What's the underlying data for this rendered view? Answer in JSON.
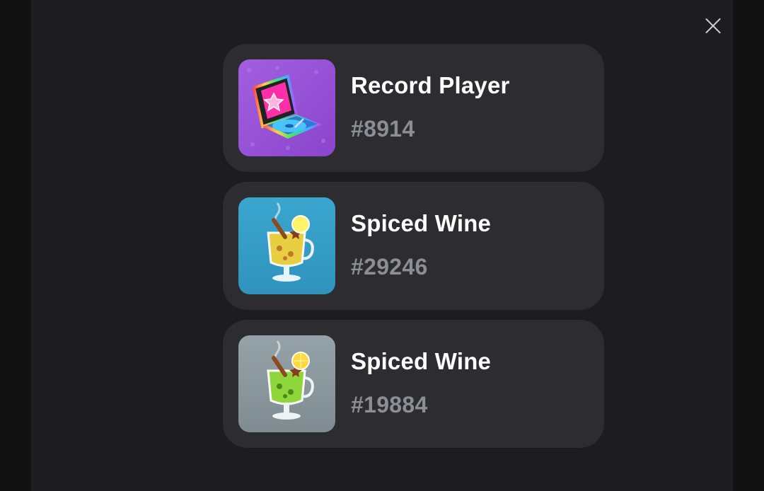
{
  "close_icon": "close-icon",
  "items": [
    {
      "title": "Record Player",
      "number": "#8914",
      "bg": "#9b59d6",
      "icon": "record-player-icon"
    },
    {
      "title": "Spiced Wine",
      "number": "#29246",
      "bg": "#3aa3c9",
      "icon": "spiced-wine-icon"
    },
    {
      "title": "Spiced Wine",
      "number": "#19884",
      "bg": "#8c9aa0",
      "icon": "spiced-wine-icon"
    }
  ],
  "colors": {
    "page_bg": "#121212",
    "modal_bg": "#1d1d1f",
    "card_bg": "#2c2c31",
    "title_text": "#ffffff",
    "number_text": "#8d8d94"
  }
}
